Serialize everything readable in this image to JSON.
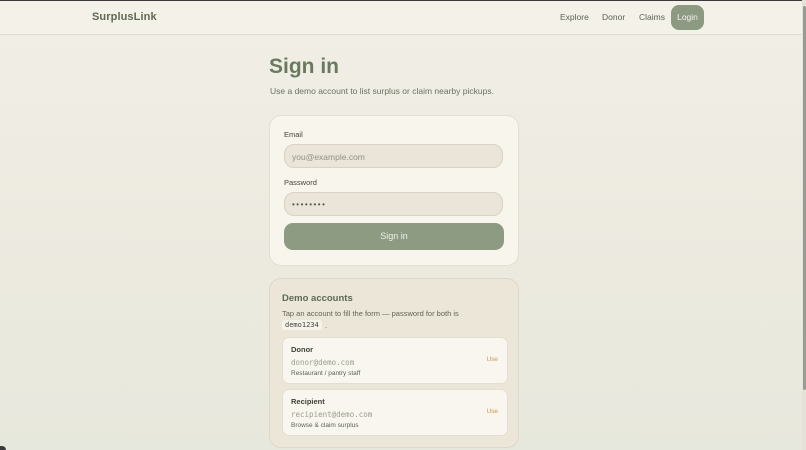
{
  "header": {
    "brand": "SurplusLink",
    "nav": [
      "Explore",
      "Donor",
      "Claims"
    ],
    "login_label": "Login"
  },
  "page": {
    "title": "Sign in",
    "subtitle": "Use a demo account to list surplus or claim nearby pickups."
  },
  "form": {
    "email_label": "Email",
    "email_placeholder": "you@example.com",
    "password_label": "Password",
    "password_value": "••••••••",
    "submit_label": "Sign in"
  },
  "demo": {
    "title": "Demo accounts",
    "description": "Tap an account to fill the form — password for both is",
    "password_code": "demo1234",
    "trailing": ".",
    "accounts": [
      {
        "name": "Donor",
        "email": "donor@demo.com",
        "role": "Restaurant / pantry staff",
        "action": "Use"
      },
      {
        "name": "Recipient",
        "email": "recipient@demo.com",
        "role": "Browse & claim surplus",
        "action": "Use"
      }
    ]
  },
  "colors": {
    "accent": "#8b9a80",
    "brand_text": "#5e6b54",
    "use_link": "#c79a5a",
    "background": "#eeece2"
  }
}
